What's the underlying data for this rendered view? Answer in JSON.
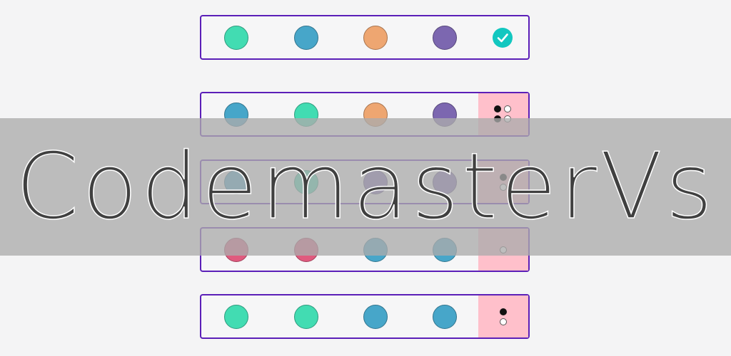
{
  "app_title": "CodemasterVs",
  "colors": {
    "green": "#42dcb2",
    "blue": "#47a6c9",
    "orange": "#eea671",
    "purple": "#7c67b0",
    "red": "#e05a7e",
    "row_border": "#5b1fb8",
    "feedback_bg": "#ffc0cb",
    "check": "#12c7c0"
  },
  "rows": [
    {
      "pegs": [
        "green",
        "blue",
        "orange",
        "purple"
      ],
      "feedback": "check"
    },
    {
      "pegs": [
        "blue",
        "green",
        "orange",
        "purple"
      ],
      "feedback": {
        "black": 2,
        "white": 2
      }
    },
    {
      "pegs": [
        "blue",
        "green",
        "purple",
        "purple"
      ],
      "feedback": {
        "black": 1,
        "white": 1
      }
    },
    {
      "pegs": [
        "red",
        "red",
        "blue",
        "blue"
      ],
      "feedback": {
        "black": 0,
        "white": 1
      }
    },
    {
      "pegs": [
        "green",
        "green",
        "blue",
        "blue"
      ],
      "feedback": {
        "black": 1,
        "white": 1
      }
    }
  ]
}
